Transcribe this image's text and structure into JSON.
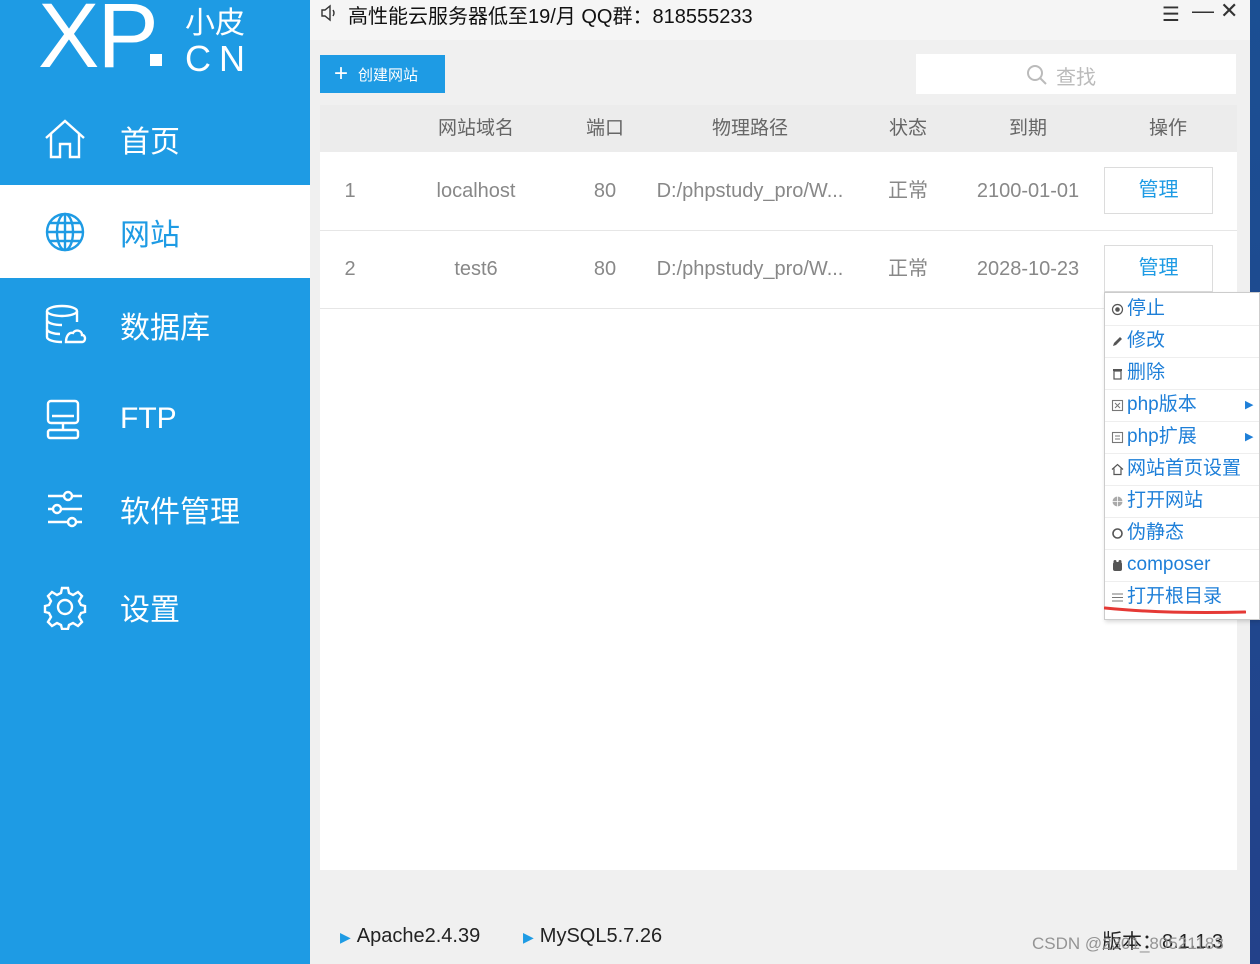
{
  "sidebar": {
    "logo": {
      "main": "XP",
      "cn_top": "小皮",
      "cn_bottom": "CN"
    },
    "items": [
      {
        "label": "首页",
        "icon": "home-icon"
      },
      {
        "label": "网站",
        "icon": "globe-icon",
        "active": true
      },
      {
        "label": "数据库",
        "icon": "database-icon"
      },
      {
        "label": "FTP",
        "icon": "server-icon"
      },
      {
        "label": "软件管理",
        "icon": "sliders-icon"
      },
      {
        "label": "设置",
        "icon": "gear-icon"
      }
    ]
  },
  "titlebar": {
    "notice": "高性能云服务器低至19/月  QQ群：818555233"
  },
  "toolbar": {
    "create_label": "创建网站",
    "search_placeholder": "查找"
  },
  "table": {
    "headers": [
      "网站域名",
      "端口",
      "物理路径",
      "状态",
      "到期",
      "操作"
    ],
    "rows": [
      {
        "index": "1",
        "domain": "localhost",
        "port": "80",
        "path": "D:/phpstudy_pro/W...",
        "status": "正常",
        "expiry": "2100-01-01",
        "action": "管理"
      },
      {
        "index": "2",
        "domain": "test6",
        "port": "80",
        "path": "D:/phpstudy_pro/W...",
        "status": "正常",
        "expiry": "2028-10-23",
        "action": "管理"
      }
    ]
  },
  "context_menu": {
    "items": [
      {
        "label": "停止",
        "icon": "stop-icon"
      },
      {
        "label": "修改",
        "icon": "pencil-icon"
      },
      {
        "label": "删除",
        "icon": "trash-icon"
      },
      {
        "label": "php版本",
        "icon": "php-version-icon",
        "submenu": true
      },
      {
        "label": "php扩展",
        "icon": "php-extension-icon",
        "submenu": true
      },
      {
        "label": "网站首页设置",
        "icon": "home-small-icon"
      },
      {
        "label": "打开网站",
        "icon": "globe-small-icon"
      },
      {
        "label": "伪静态",
        "icon": "cycle-icon"
      },
      {
        "label": "composer",
        "icon": "composer-icon"
      },
      {
        "label": "打开根目录",
        "icon": "list-icon",
        "highlighted": true
      }
    ]
  },
  "footer": {
    "apache": "Apache2.4.39",
    "mysql": "MySQL5.7.26",
    "version": "版本：8.1.1.3",
    "watermark": "CSDN @2301_80521183"
  },
  "colors": {
    "accent": "#1e9be4",
    "link": "#1e7fd8",
    "highlight_line": "#e53935"
  }
}
